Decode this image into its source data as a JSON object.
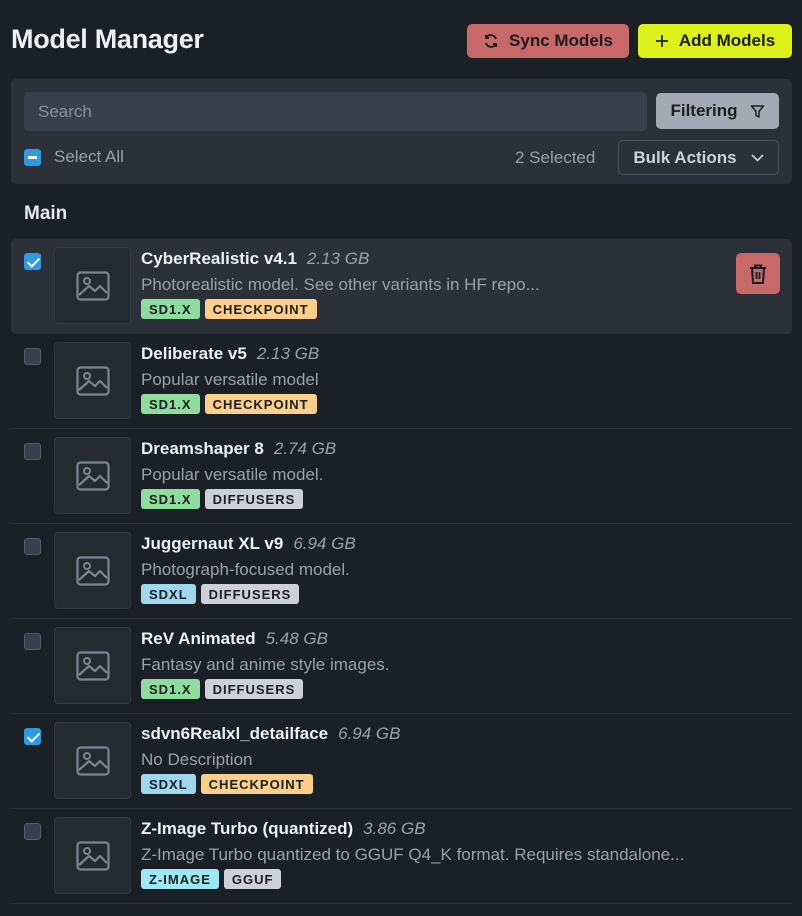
{
  "header": {
    "title": "Model Manager",
    "sync_label": "Sync Models",
    "add_label": "Add Models"
  },
  "toolbar": {
    "search_placeholder": "Search",
    "filter_label": "Filtering",
    "select_all_label": "Select All",
    "selected_count": "2 Selected",
    "bulk_label": "Bulk Actions"
  },
  "section": {
    "title": "Main"
  },
  "models": [
    {
      "name": "CyberRealistic v4.1",
      "size": "2.13 GB",
      "desc": "Photorealistic model. See other variants in HF repo...",
      "checked": true,
      "active": true,
      "tags": [
        {
          "label": "SD1.X",
          "color": "#8edc9e"
        },
        {
          "label": "CHECKPOINT",
          "color": "#f9cf8b"
        }
      ]
    },
    {
      "name": "Deliberate v5",
      "size": "2.13 GB",
      "desc": "Popular versatile model",
      "checked": false,
      "active": false,
      "tags": [
        {
          "label": "SD1.X",
          "color": "#8edc9e"
        },
        {
          "label": "CHECKPOINT",
          "color": "#f9cf8b"
        }
      ]
    },
    {
      "name": "Dreamshaper 8",
      "size": "2.74 GB",
      "desc": "Popular versatile model.",
      "checked": false,
      "active": false,
      "tags": [
        {
          "label": "SD1.X",
          "color": "#8edc9e"
        },
        {
          "label": "DIFFUSERS",
          "color": "#cdd1d7"
        }
      ]
    },
    {
      "name": "Juggernaut XL v9",
      "size": "6.94 GB",
      "desc": "Photograph-focused model.",
      "checked": false,
      "active": false,
      "tags": [
        {
          "label": "SDXL",
          "color": "#9fd6f0"
        },
        {
          "label": "DIFFUSERS",
          "color": "#cdd1d7"
        }
      ]
    },
    {
      "name": "ReV Animated",
      "size": "5.48 GB",
      "desc": "Fantasy and anime style images.",
      "checked": false,
      "active": false,
      "tags": [
        {
          "label": "SD1.X",
          "color": "#8edc9e"
        },
        {
          "label": "DIFFUSERS",
          "color": "#cdd1d7"
        }
      ]
    },
    {
      "name": "sdvn6Realxl_detailface",
      "size": "6.94 GB",
      "desc": "No Description",
      "checked": true,
      "active": false,
      "tags": [
        {
          "label": "SDXL",
          "color": "#9fd6f0"
        },
        {
          "label": "CHECKPOINT",
          "color": "#f9cf8b"
        }
      ]
    },
    {
      "name": "Z-Image Turbo (quantized)",
      "size": "3.86 GB",
      "desc": "Z-Image Turbo quantized to GGUF Q4_K format. Requires standalone...",
      "checked": false,
      "active": false,
      "tags": [
        {
          "label": "Z-IMAGE",
          "color": "#9ee8f5"
        },
        {
          "label": "GGUF",
          "color": "#cdd1d7"
        }
      ]
    }
  ]
}
